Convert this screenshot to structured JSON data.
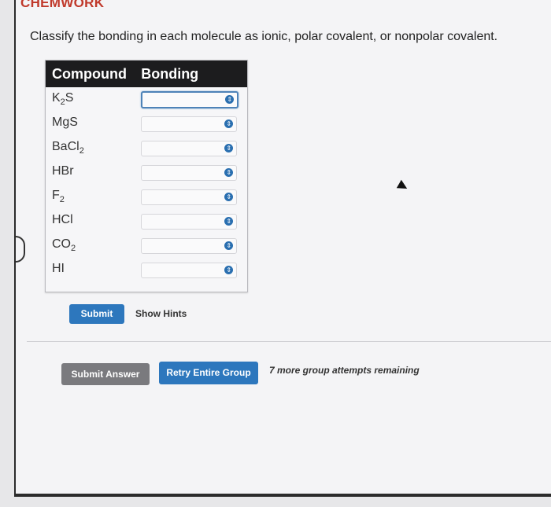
{
  "header": {
    "app_name": "CHEMWORK"
  },
  "question": {
    "prompt": "Classify the bonding in each molecule as ionic, polar covalent, or nonpolar covalent."
  },
  "table": {
    "columns": [
      "Compound",
      "Bonding"
    ],
    "rows": [
      {
        "formula": "K",
        "sub": "2",
        "suffix": "S",
        "value": ""
      },
      {
        "formula": "MgS",
        "sub": "",
        "suffix": "",
        "value": ""
      },
      {
        "formula": "BaCl",
        "sub": "2",
        "suffix": "",
        "value": ""
      },
      {
        "formula": "HBr",
        "sub": "",
        "suffix": "",
        "value": ""
      },
      {
        "formula": "F",
        "sub": "2",
        "suffix": "",
        "value": ""
      },
      {
        "formula": "HCl",
        "sub": "",
        "suffix": "",
        "value": ""
      },
      {
        "formula": "CO",
        "sub": "2",
        "suffix": "",
        "value": ""
      },
      {
        "formula": "HI",
        "sub": "",
        "suffix": "",
        "value": ""
      }
    ]
  },
  "actions": {
    "submit_label": "Submit",
    "hints_label": "Show Hints",
    "submit_answer_label": "Submit Answer",
    "retry_label": "Retry Entire Group",
    "attempts_text": "7 more group attempts remaining"
  },
  "colors": {
    "accent": "#2d77bd",
    "header_bg": "#1c1c1e",
    "disabled": "#7a7a7e",
    "brand": "#c0392b"
  }
}
